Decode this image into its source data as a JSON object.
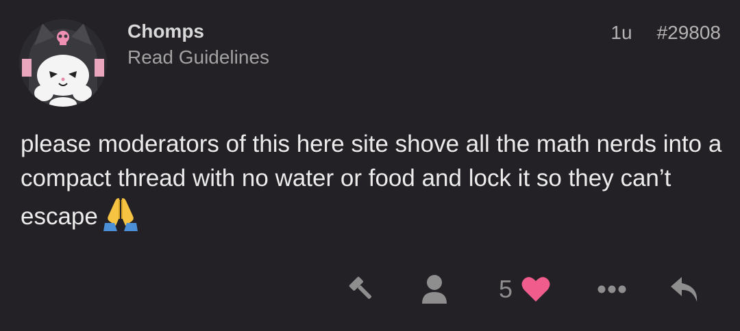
{
  "post": {
    "username": "Chomps",
    "user_title": "Read Guidelines",
    "age": "1u",
    "post_number": "#29808",
    "body": "please moderators of this here site shove all the math nerds into a compact thread with no water or food and lock it so they can’t escape",
    "emoji": "folded-hands-emoji"
  },
  "actions": {
    "like_count": "5",
    "icons": [
      "gavel-icon",
      "user-icon",
      "heart-icon",
      "ellipsis-icon",
      "reply-icon"
    ]
  },
  "colors": {
    "background": "#232125",
    "heart": "#f05d8c",
    "muted_icon": "#8e8e8e"
  }
}
